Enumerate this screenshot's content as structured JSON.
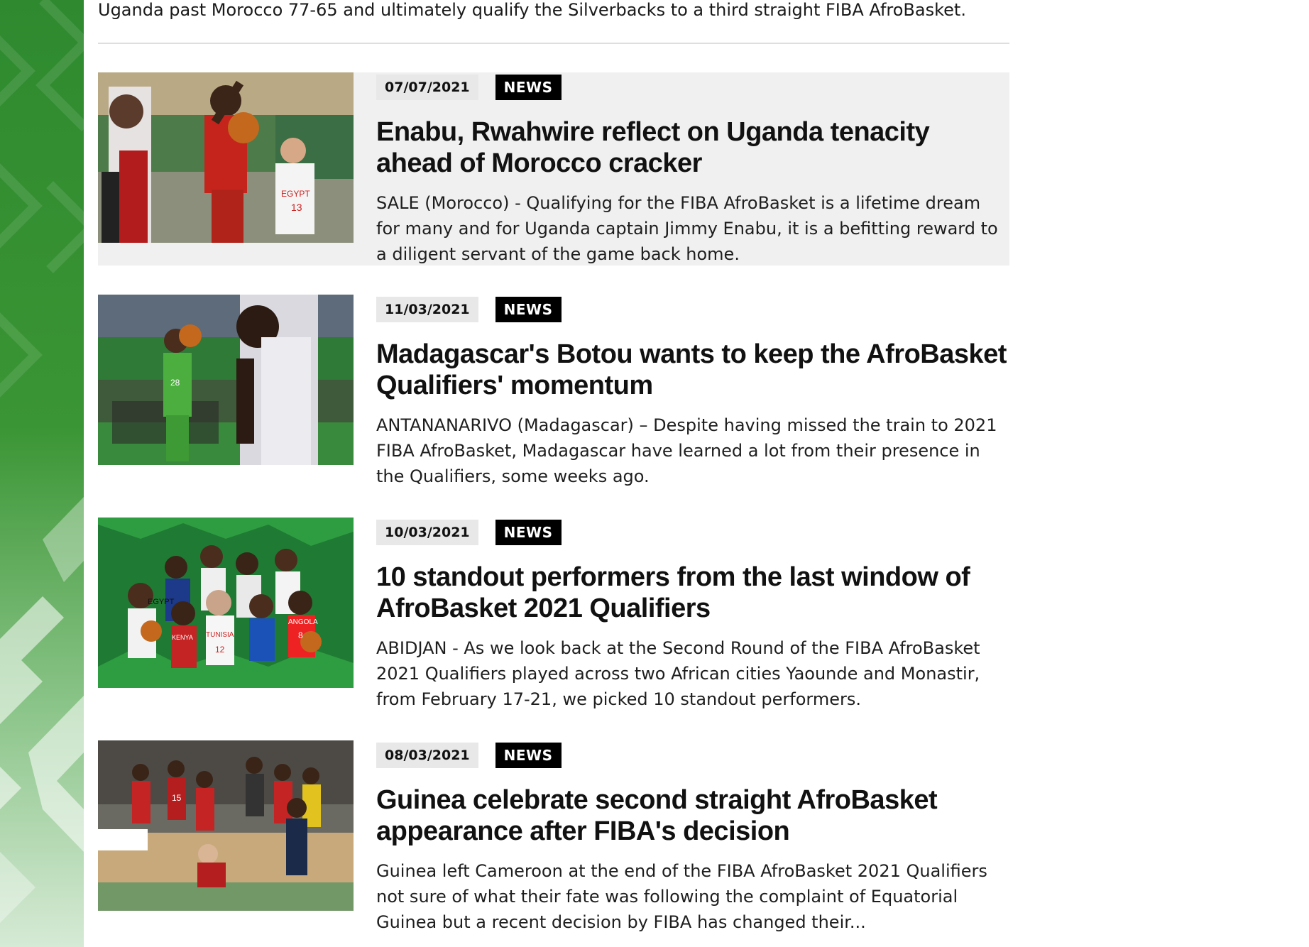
{
  "intro_text": "Uganda past Morocco 77-65 and ultimately qualify the Silverbacks to a third straight FIBA AfroBasket.",
  "articles": [
    {
      "date": "07/07/2021",
      "tag": "NEWS",
      "title": "Enabu, Rwahwire reflect on Uganda tenacity ahead of Morocco cracker",
      "summary": "SALE (Morocco) - Qualifying for the FIBA AfroBasket is a lifetime dream for many and for Uganda captain Jimmy Enabu, it is a befitting reward to a diligent servant of the game back home.",
      "thumb_jersey_labels": [
        "EGYPT",
        "13"
      ]
    },
    {
      "date": "11/03/2021",
      "tag": "NEWS",
      "title": "Madagascar's Botou wants to keep the AfroBasket Qualifiers' momentum",
      "summary": "ANTANANARIVO (Madagascar) – Despite having missed the train to 2021 FIBA AfroBasket, Madagascar have learned a lot from their presence in the Qualifiers, some weeks ago.",
      "thumb_jersey_labels": [
        "28"
      ]
    },
    {
      "date": "10/03/2021",
      "tag": "NEWS",
      "title": "10 standout performers from the last window of AfroBasket 2021 Qualifiers",
      "summary": "ABIDJAN - As we look back at the Second Round of the FIBA AfroBasket 2021 Qualifiers played across two African cities Yaounde and Monastir, from February 17-21, we picked 10 standout performers.",
      "thumb_jersey_labels": [
        "EGYPT",
        "KENYA",
        "TUNISIA",
        "ANGOLA",
        "12",
        "8"
      ]
    },
    {
      "date": "08/03/2021",
      "tag": "NEWS",
      "title": "Guinea celebrate second straight AfroBasket appearance after FIBA's decision",
      "summary": "Guinea left Cameroon at the end of the FIBA AfroBasket 2021 Qualifiers not sure of what their fate was following the complaint of Equatorial Guinea but a recent decision by FIBA has changed their...",
      "thumb_jersey_labels": [
        "15"
      ]
    }
  ],
  "colors": {
    "side_green": "#2f8a2f",
    "tag_bg": "#000000",
    "date_bg": "#e8e8e8",
    "highlight_bg": "#f0f0f0"
  }
}
